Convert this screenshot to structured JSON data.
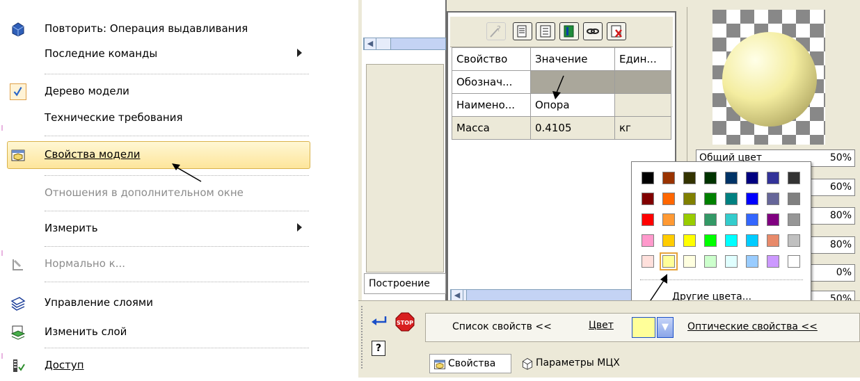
{
  "menu": {
    "items": [
      {
        "label": "Повторить: Операция выдавливания",
        "icon": "extrude-icon"
      },
      {
        "label": "Последние команды",
        "icon": "",
        "submenu": true
      },
      {
        "label": "Дерево модели",
        "icon": "checkmark-icon",
        "checked": true
      },
      {
        "label": "Технические требования",
        "icon": ""
      },
      {
        "label": "Свойства модели",
        "icon": "model-properties-icon",
        "highlighted": true
      },
      {
        "label": "Отношения в дополнительном окне",
        "icon": "",
        "disabled": true
      },
      {
        "label": "Измерить",
        "icon": "",
        "submenu": true
      },
      {
        "label": "Нормально к...",
        "icon": "normal-to-icon",
        "disabled": true
      },
      {
        "label": "Управление слоями",
        "icon": "layers-icon"
      },
      {
        "label": "Изменить слой",
        "icon": "change-layer-icon"
      },
      {
        "label": "Доступ",
        "icon": "access-icon"
      }
    ]
  },
  "tree_tab": {
    "label": "Построение"
  },
  "properties_table": {
    "headers": [
      "Свойство",
      "Значение",
      "Един..."
    ],
    "rows": [
      [
        "Обознач...",
        "",
        ""
      ],
      [
        "Наимено...",
        "Опора",
        ""
      ],
      [
        "Масса",
        "0.4105",
        "кг"
      ]
    ]
  },
  "toolbar": {
    "icons": [
      "wizard-icon",
      "document-icon",
      "list-icon",
      "book-icon",
      "link-icon",
      "delete-icon"
    ]
  },
  "optics": {
    "general_color_label": "Общий цвет",
    "values": [
      "50%",
      "60%",
      "80%",
      "80%",
      "0%",
      "50%"
    ]
  },
  "color_popup": {
    "other_colors": "Другие цвета...",
    "colors": [
      [
        "#000000",
        "#993300",
        "#333300",
        "#003300",
        "#003366",
        "#000080",
        "#333399",
        "#333333"
      ],
      [
        "#800000",
        "#ff6600",
        "#808000",
        "#008000",
        "#008080",
        "#0000ff",
        "#666699",
        "#808080"
      ],
      [
        "#ff0000",
        "#ff9933",
        "#99cc00",
        "#339966",
        "#33cccc",
        "#3366ff",
        "#800080",
        "#969696"
      ],
      [
        "#ff99cc",
        "#ffcc00",
        "#ffff00",
        "#00ff00",
        "#00ffff",
        "#00ccff",
        "#e88a6a",
        "#c0c0c0"
      ],
      [
        "#ffe0dc",
        "#ffff99",
        "#ffffe0",
        "#ccffcc",
        "#e0ffff",
        "#99ccff",
        "#cc99ff",
        "#ffffff"
      ]
    ],
    "selected": "#ffff99"
  },
  "bottom_bar": {
    "properties_list": "Список свойств  <<",
    "color_label": "Цвет",
    "color_value": "#ffff99",
    "optical_properties": "Оптические свойства  <<"
  },
  "bottom_tabs": {
    "properties": "Свойства",
    "mch_params": "Параметры МЦХ"
  }
}
